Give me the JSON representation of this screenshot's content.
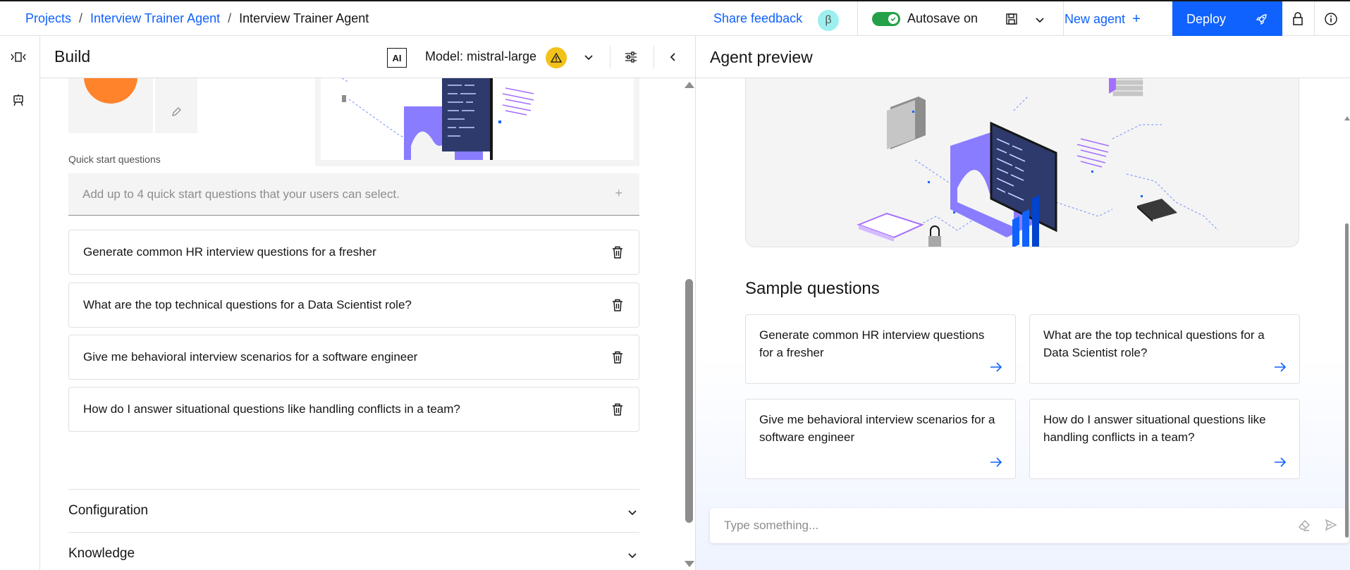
{
  "breadcrumb": {
    "items": [
      "Projects",
      "Interview Trainer Agent"
    ],
    "current": "Interview Trainer Agent",
    "separator": "/"
  },
  "header": {
    "feedback": "Share feedback",
    "beta": "β",
    "autosave": "Autosave on",
    "new_agent": "New agent",
    "new_agent_plus": "+",
    "deploy": "Deploy"
  },
  "build": {
    "title": "Build",
    "ai_badge": "AI",
    "model": "Model: mistral-large",
    "quick_start_label": "Quick start questions",
    "quick_start_placeholder": "Add up to 4 quick start questions that your users can select.",
    "add_symbol": "+",
    "questions": [
      "Generate common HR interview questions for a fresher",
      "What are the top technical questions for a Data Scientist role?",
      "Give me behavioral interview scenarios for a software engineer",
      "How do I answer situational questions like handling conflicts in a team?"
    ],
    "sections": [
      "Configuration",
      "Knowledge"
    ]
  },
  "preview": {
    "title": "Agent preview",
    "sample_title": "Sample questions",
    "samples": [
      "Generate common HR interview questions for a fresher",
      "What are the top technical questions for a Data Scientist role?",
      "Give me behavioral interview scenarios for a software engineer",
      "How do I answer situational questions like handling conflicts in a team?"
    ],
    "chat_placeholder": "Type something..."
  },
  "colors": {
    "accent": "#0f62fe",
    "toggle_on": "#24a148",
    "warning": "#f1c21b",
    "avatar": "#ff832b",
    "illustration": "#8a7cff"
  },
  "icons": [
    "save-icon",
    "chevron-down-icon",
    "rocket-icon",
    "lock-icon",
    "info-icon",
    "warning-icon",
    "sliders-icon",
    "chevron-left-icon",
    "trash-icon",
    "arrow-right-icon",
    "eraser-icon",
    "send-icon",
    "agent-icon",
    "build-icon"
  ]
}
